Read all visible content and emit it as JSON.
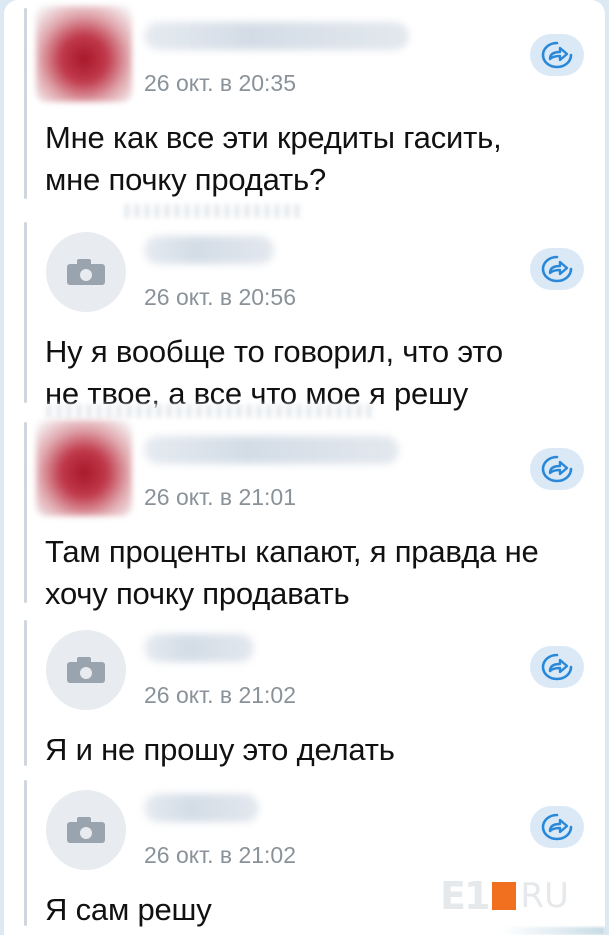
{
  "messages": [
    {
      "date": "26 окт. в 20:35",
      "text_lines": [
        "Мне как все эти кредиты гасить,",
        "мне почку продать?"
      ],
      "avatar": "photo"
    },
    {
      "date": "26 окт. в 20:56",
      "text_lines": [
        "Ну я вообще то говорил, что это",
        "не твое, а все что мое я решу"
      ],
      "avatar": "camera-icon"
    },
    {
      "date": "26 окт. в 21:01",
      "text_lines": [
        "Там проценты капают, я правда не",
        "хочу почку продавать"
      ],
      "avatar": "photo"
    },
    {
      "date": "26 окт. в 21:02",
      "text_lines": [
        "Я и не прошу это делать"
      ],
      "avatar": "camera-icon"
    },
    {
      "date": "26 окт. в 21:02",
      "text_lines": [
        "Я сам решу"
      ],
      "avatar": "camera-icon"
    }
  ],
  "share_icon": "share-arrow-icon",
  "watermark": {
    "logo_text": "E1",
    "domain_text": "RU",
    "accent": "#f07020"
  },
  "colors": {
    "background": "#dce9f3",
    "card": "#ffffff",
    "share_button": "#dbe9f7",
    "share_icon": "#2a88d8",
    "date_text": "#8a9299"
  }
}
